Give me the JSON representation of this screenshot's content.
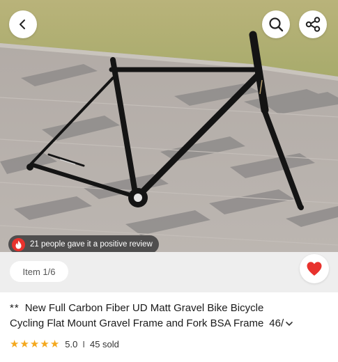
{
  "header": {
    "back_icon": "chevron-left-icon",
    "search_icon": "search-icon",
    "share_icon": "share-icon"
  },
  "gallery": {
    "review_badge": "21 people gave it a positive review",
    "review_badge_icon": "flame-icon",
    "counter": "Item 1/6",
    "wishlist_icon": "heart-icon",
    "wishlist_color": "#e8322d"
  },
  "product": {
    "title_prefix": "**",
    "title_line1": "New Full Carbon Fiber UD Matt Gravel Bike Bicycle",
    "title_line2": "Cycling Flat Mount Gravel Frame and Fork BSA Frame",
    "title_count": "46/",
    "expand_icon": "chevron-down-icon",
    "rating": "5.0",
    "separator": "I",
    "sold": "45 sold",
    "star_color": "#f4a81d"
  }
}
